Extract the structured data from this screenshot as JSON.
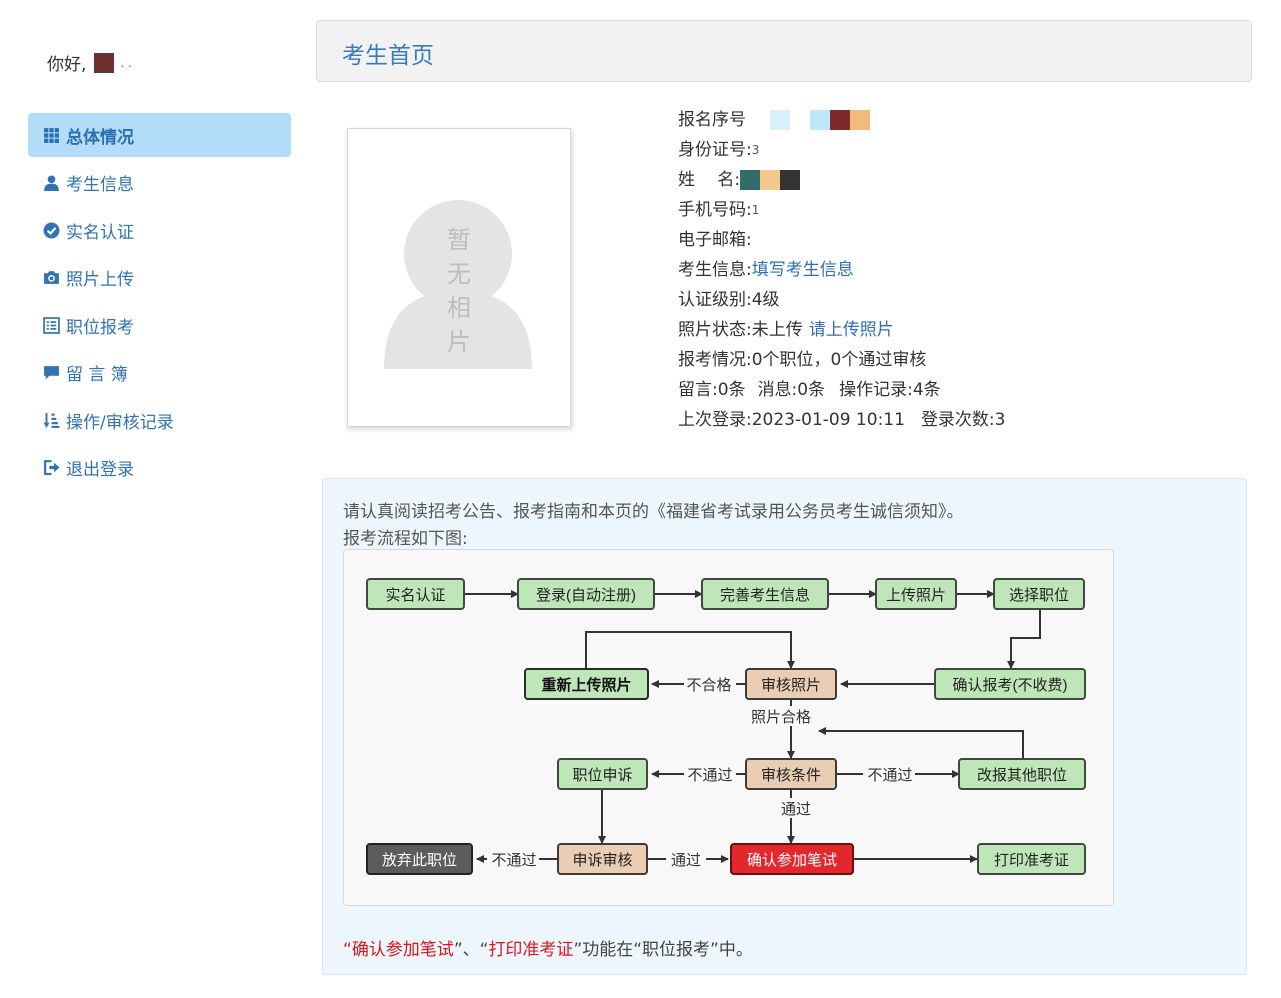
{
  "sidebar": {
    "greeting": "你好,",
    "items": [
      {
        "label": "总体情况",
        "icon": "grid-icon"
      },
      {
        "label": "考生信息",
        "icon": "user-icon"
      },
      {
        "label": "实名认证",
        "icon": "check-circle-icon"
      },
      {
        "label": "照片上传",
        "icon": "camera-icon"
      },
      {
        "label": "职位报考",
        "icon": "list-icon"
      },
      {
        "label": "留 言 簿",
        "icon": "comment-icon"
      },
      {
        "label": "操作/审核记录",
        "icon": "sort-icon"
      },
      {
        "label": "退出登录",
        "icon": "logout-icon"
      }
    ]
  },
  "header": {
    "title": "考生首页"
  },
  "photo": {
    "placeholder": "暂无相片"
  },
  "info": {
    "reg_no_label": "报名序号",
    "id_label": "身份证号:",
    "id_value": "3",
    "name_label": "姓　 名:",
    "phone_label": "手机号码:",
    "phone_value": "1",
    "email_label": "电子邮箱:",
    "profile_label": "考生信息:",
    "profile_link": "填写考生信息",
    "level_label": "认证级别:",
    "level_value": "4级",
    "photo_status_label": "照片状态:",
    "photo_status_value": "未上传",
    "photo_upload_link": "请上传照片",
    "apply_label": "报考情况:",
    "apply_value": "0个职位，0个通过审核",
    "msg_label": "留言:",
    "msg_value": "0条",
    "notice_label": "消息:",
    "notice_value": "0条",
    "ops_label": "操作记录:",
    "ops_value": "4条",
    "last_login_label": "上次登录:",
    "last_login_value": "2023-01-09 10:11",
    "login_count_label": "登录次数:",
    "login_count_value": "3"
  },
  "notice": {
    "line1": "请认真阅读招考公告、报考指南和本页的《福建省考试录用公务员考生诚信须知》。",
    "line2": "报考流程如下图:",
    "foot_q1": "“",
    "foot_r1": "确认参加笔试",
    "foot_q2": "”、“",
    "foot_r2": "打印准考证",
    "foot_rest": "”功能在“职位报考”中。"
  },
  "flow": {
    "n1": "实名认证",
    "n2": "登录(自动注册)",
    "n3": "完善考生信息",
    "n4": "上传照片",
    "n5": "选择职位",
    "n6": "重新上传照片",
    "n7": "审核照片",
    "n8": "确认报考(不收费)",
    "n9": "职位申诉",
    "n10": "审核条件",
    "n11": "改报其他职位",
    "n12": "放弃此职位",
    "n13": "申诉审核",
    "n14": "确认参加笔试",
    "n15": "打印准考证",
    "l_fail1": "不合格",
    "l_photo_ok": "照片合格",
    "l_notpass1": "不通过",
    "l_notpass2": "不通过",
    "l_pass1": "通过",
    "l_notpass3": "不通过",
    "l_pass2": "通过"
  },
  "colors": {
    "accent": "#3173b4",
    "active_bg": "#b3dcf8",
    "green_node": "#bfe6b8",
    "tan_node": "#e9cdb4",
    "dark_node": "#5c5c5c",
    "red_node": "#e4262d",
    "red_text": "#e0151b"
  }
}
